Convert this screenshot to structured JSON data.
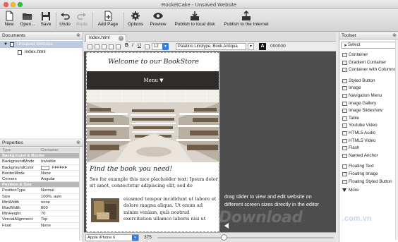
{
  "window": {
    "title": "RocketCake - Unsaved Website"
  },
  "toolbar": {
    "buttons": [
      {
        "label": "New",
        "icon": "new-file-icon",
        "enabled": true
      },
      {
        "label": "Open...",
        "icon": "open-folder-icon",
        "enabled": true
      },
      {
        "label": "Save",
        "icon": "save-disk-icon",
        "enabled": true
      },
      {
        "label": "Undo",
        "icon": "undo-icon",
        "enabled": true
      },
      {
        "label": "Redo",
        "icon": "redo-icon",
        "enabled": false
      },
      {
        "label": "Add Page",
        "icon": "add-page-icon",
        "enabled": true
      },
      {
        "label": "Options",
        "icon": "gear-icon",
        "enabled": true
      },
      {
        "label": "Preview",
        "icon": "eye-icon",
        "enabled": true
      },
      {
        "label": "Publish to local disk",
        "icon": "publish-disk-icon",
        "enabled": true
      },
      {
        "label": "Publish to the Internet",
        "icon": "publish-internet-icon",
        "enabled": true
      }
    ]
  },
  "documents": {
    "title": "Documents",
    "tree": [
      {
        "label": "Unsaved Website",
        "selected": true
      },
      {
        "label": "index.html",
        "selected": false
      }
    ]
  },
  "properties": {
    "title": "Properties",
    "header": {
      "key": "Type",
      "value": "Container"
    },
    "rows": [
      {
        "key": "Background & Border",
        "value": "",
        "section": true
      },
      {
        "key": "BackgroundMode",
        "value": "Invisible"
      },
      {
        "key": "BackgroundColor",
        "value": "FFFFFF",
        "swatch": "#ffffff"
      },
      {
        "key": "BorderMode",
        "value": "None"
      },
      {
        "key": "Corners",
        "value": "Angular"
      },
      {
        "key": "Position & Size",
        "value": "",
        "section": true
      },
      {
        "key": "PositionType",
        "value": "Normal"
      },
      {
        "key": "Size",
        "value": "100%, auto"
      },
      {
        "key": "MinWidth",
        "value": "none"
      },
      {
        "key": "MaxWidth",
        "value": "800"
      },
      {
        "key": "MinHeight",
        "value": "70"
      },
      {
        "key": "VercialAlignment",
        "value": "Top"
      },
      {
        "key": "Float",
        "value": "None"
      }
    ]
  },
  "editor": {
    "tab": "index.html",
    "format": {
      "size": "12",
      "font": "Palatino Linotype, Book Antiqua",
      "color": "000000"
    },
    "page": {
      "heading": "Welcome to our BookStore",
      "menu": "Menu",
      "subheading": "Find the book you need!",
      "paragraph1": "See for example this nice placholder text: Ipsum dolor sit amet, consectetur adipiscing elit, sed do",
      "paragraph2": "eiusmod tempor incididunt ut labore et dolore magna aliqua. Ut enum ad minim veniam, quis nostrud exercitation ullamco laboris nisi ut"
    },
    "hint": "drag slider to view and edit website on different screen sizes directly in the editor",
    "device": "Apple iPhone 6",
    "width": "375",
    "slider_fraction": 0.0
  },
  "toolset": {
    "title": "Toolset",
    "select": "Select",
    "items": [
      {
        "label": "Container"
      },
      {
        "label": "Gradient Container"
      },
      {
        "label": "Container with Columns"
      },
      {
        "label": "Styled Button"
      },
      {
        "label": "Image"
      },
      {
        "label": "Navigation Menu"
      },
      {
        "label": "Image Gallery"
      },
      {
        "label": "Image Slideshow"
      },
      {
        "label": "Table"
      },
      {
        "label": "Youtube Video"
      },
      {
        "label": "HTML5 Audio"
      },
      {
        "label": "HTML5 Video"
      },
      {
        "label": "Flash"
      },
      {
        "label": "Named Anchor"
      },
      {
        "label": "Floating Text"
      },
      {
        "label": "Floating Image"
      },
      {
        "label": "Floating Styled Button"
      },
      {
        "label": "More"
      }
    ]
  },
  "watermark": {
    "text": "Download",
    "suffix": ".com.vn"
  },
  "colors": {
    "accent": "#2e7de0",
    "menubar": "#2f2c29",
    "editorBg": "#4d4d4d"
  }
}
